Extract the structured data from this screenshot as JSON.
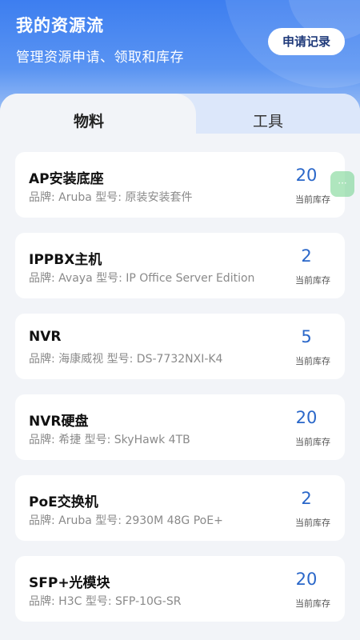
{
  "header": {
    "title": "我的资源流",
    "subtitle": "管理资源申请、领取和库存",
    "record_button": "申请记录"
  },
  "tabs": [
    {
      "label": "物料",
      "active": true
    },
    {
      "label": "工具",
      "active": false
    }
  ],
  "items": [
    {
      "name": "AP安装底座",
      "meta": "品牌: Aruba 型号:  原装安装套件",
      "qty": "20",
      "qty_label": "当前库存"
    },
    {
      "name": "IPPBX主机",
      "meta": "品牌: Avaya 型号:  IP Office Server Edition",
      "qty": "2",
      "qty_label": "当前库存"
    },
    {
      "name": "NVR",
      "meta": "品牌: 海康威视 型号:  DS-7732NXI-K4",
      "qty": "5",
      "qty_label": "当前库存"
    },
    {
      "name": "NVR硬盘",
      "meta": "品牌: 希捷 型号:  SkyHawk 4TB",
      "qty": "20",
      "qty_label": "当前库存"
    },
    {
      "name": "PoE交换机",
      "meta": "品牌: Aruba 型号:  2930M 48G PoE+",
      "qty": "2",
      "qty_label": "当前库存"
    },
    {
      "name": "SFP+光模块",
      "meta": "品牌: H3C 型号:  SFP-10G-SR",
      "qty": "20",
      "qty_label": "当前库存"
    }
  ],
  "floating_handle": {
    "icon": "more-dots-icon",
    "glyph": "···"
  },
  "colors": {
    "header_blue": "#3d7ef0",
    "qty_blue": "#2a67c9",
    "background": "#f2f4f8"
  }
}
